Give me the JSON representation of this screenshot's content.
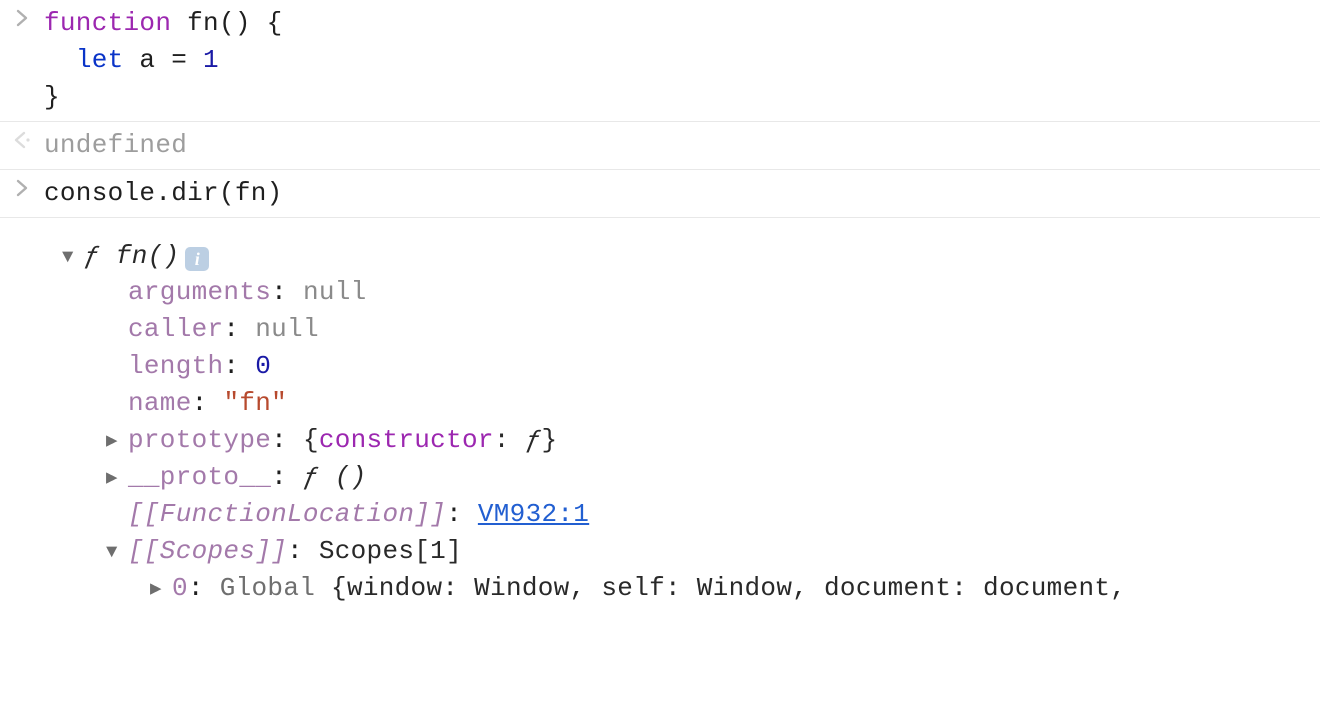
{
  "entries": {
    "input1": {
      "line1_kw_function": "function",
      "line1_rest": " fn() {",
      "line2_indent": "  ",
      "line2_kw_let": "let",
      "line2_mid": " a = ",
      "line2_num": "1",
      "line3": "}"
    },
    "output1": {
      "text": "undefined"
    },
    "input2": {
      "text": "console.dir(fn)"
    }
  },
  "inspector": {
    "header": {
      "f_glyph": "ƒ",
      "signature": " fn()",
      "info_glyph": "i"
    },
    "props": {
      "arguments": {
        "name": "arguments",
        "value": "null"
      },
      "caller": {
        "name": "caller",
        "value": "null"
      },
      "length": {
        "name": "length",
        "value": "0"
      },
      "name_prop": {
        "name": "name",
        "value": "\"fn\""
      },
      "prototype": {
        "name": "prototype",
        "preview_open": "{",
        "preview_key": "constructor",
        "preview_sep": ": ",
        "preview_val": "ƒ",
        "preview_close": "}"
      },
      "proto": {
        "name": "__proto__",
        "value_f": "ƒ",
        "value_rest": " ()"
      },
      "function_location": {
        "name": "[[FunctionLocation]]",
        "value": "VM932:1"
      },
      "scopes": {
        "name": "[[Scopes]]",
        "value": "Scopes[1]"
      },
      "scope0": {
        "index": "0",
        "label": "Global",
        "preview": "{window: Window, self: Window, document: document,"
      }
    }
  },
  "glyphs": {
    "tri_right": "▶",
    "tri_down": "▼"
  }
}
